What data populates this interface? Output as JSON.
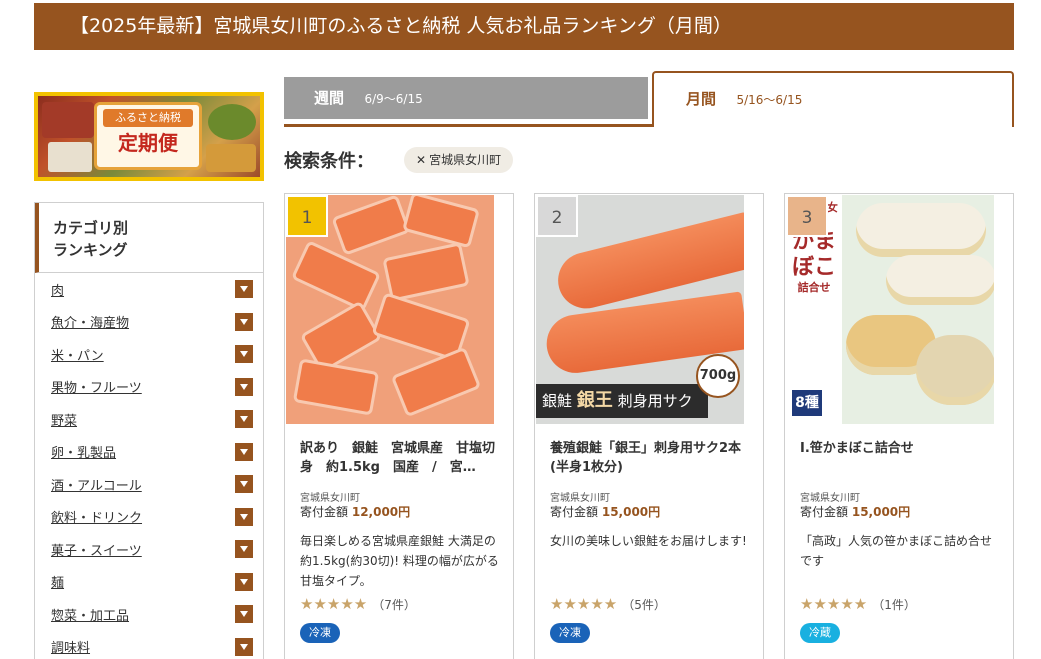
{
  "title": "【2025年最新】宮城県女川町のふるさと納税 人気お礼品ランキング（月間）",
  "banner": {
    "line1": "ふるさと納税",
    "line2": "定期便"
  },
  "sidebar": {
    "heading_line1": "カテゴリ別",
    "heading_line2": "ランキング",
    "categories": [
      "肉",
      "魚介・海産物",
      "米・パン",
      "果物・フルーツ",
      "野菜",
      "卵・乳製品",
      "酒・アルコール",
      "飲料・ドリンク",
      "菓子・スイーツ",
      "麺",
      "惣菜・加工品",
      "調味料"
    ]
  },
  "tabs": {
    "weekly": {
      "label": "週間",
      "date": "6/9～6/15"
    },
    "monthly": {
      "label": "月間",
      "date": "5/16～6/15"
    }
  },
  "search": {
    "label": "検索条件：",
    "chip_x": "✕",
    "chip": "宮城県女川町"
  },
  "colors": {
    "brand": "#96541f",
    "rank1": "#f2c200",
    "rank2": "#d8d8d8",
    "rank3": "#e8b48a",
    "frozen": "#1a63b8",
    "chilled": "#19b0e0",
    "star": "#c9a46a"
  },
  "products": [
    {
      "rank": "1",
      "title": "訳あり　銀鮭　宮城県産　甘塩切身　約1.5kg　国産　/　宮…",
      "location": "宮城県女川町",
      "price_label": "寄付金額",
      "price": "12,000円",
      "description": "毎日楽しめる宮城県産銀鮭 大満足の約1.5kg(約30切)! 料理の幅が広がる甘塩タイプ。",
      "stars": "★★★★★",
      "reviews": "（7件）",
      "badge": "冷凍"
    },
    {
      "rank": "2",
      "title": "養殖銀鮭「銀王」刺身用サク2本(半身1枚分)",
      "location": "宮城県女川町",
      "price_label": "寄付金額",
      "price": "15,000円",
      "description": "女川の美味しい銀鮭をお届けします!",
      "stars": "★★★★★",
      "reviews": "（5件）",
      "badge": "冷凍",
      "image_label_small": "銀鮭",
      "image_label_big": "銀王",
      "image_label_rest": "刺身用サク",
      "image_weight": "700g"
    },
    {
      "rank": "3",
      "title": "I.笹かまぼこ詰合せ",
      "location": "宮城県女川町",
      "price_label": "寄付金額",
      "price": "15,000円",
      "description": "「高政」人気の笹かまぼこ詰め合せです",
      "stars": "★★★★★",
      "reviews": "（1件）",
      "badge": "冷蔵",
      "image_side_small": "宮城県 女川町",
      "image_side_big": "かまぼこ",
      "image_side_sub": "詰合せ",
      "image_count": "8種"
    }
  ]
}
